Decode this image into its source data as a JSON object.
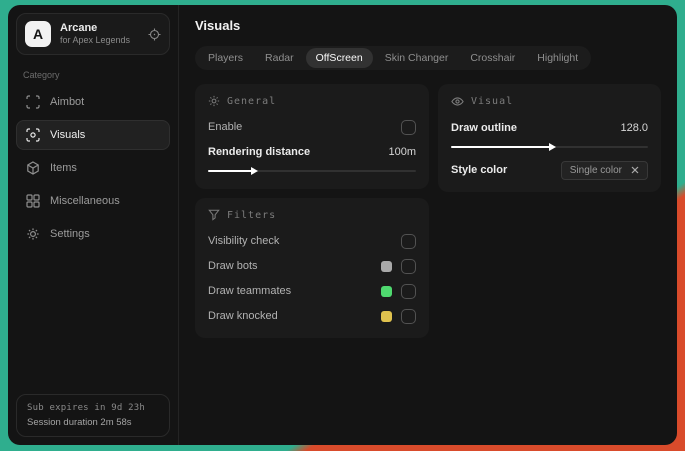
{
  "app": {
    "name": "Arcane",
    "subtitle": "for Apex Legends",
    "logo_letter": "A",
    "header_icon": "target-icon"
  },
  "sidebar": {
    "category_label": "Category",
    "items": [
      {
        "label": "Aimbot",
        "icon": "focus-frame-icon",
        "selected": false
      },
      {
        "label": "Visuals",
        "icon": "eye-scan-icon",
        "selected": true
      },
      {
        "label": "Items",
        "icon": "cube-icon",
        "selected": false
      },
      {
        "label": "Miscellaneous",
        "icon": "grid-icon",
        "selected": false
      },
      {
        "label": "Settings",
        "icon": "gear-icon",
        "selected": false
      }
    ],
    "footer": {
      "sub_expires": "Sub expires in 9d 23h",
      "session_duration": "Session duration 2m 58s"
    }
  },
  "header": {
    "title": "Visuals"
  },
  "tabs": [
    {
      "label": "Players",
      "selected": false
    },
    {
      "label": "Radar",
      "selected": false
    },
    {
      "label": "OffScreen",
      "selected": true
    },
    {
      "label": "Skin Changer",
      "selected": false
    },
    {
      "label": "Crosshair",
      "selected": false
    },
    {
      "label": "Highlight",
      "selected": false
    }
  ],
  "panels": {
    "general": {
      "title": "General",
      "icon": "sun-icon",
      "enable_label": "Enable",
      "rendering_distance_label": "Rendering distance",
      "rendering_distance_value": "100m",
      "rendering_distance_percent": 21
    },
    "filters": {
      "title": "Filters",
      "icon": "funnel-icon",
      "rows": [
        {
          "label": "Visibility check",
          "swatch": null
        },
        {
          "label": "Draw bots",
          "swatch": "#a9a9a9"
        },
        {
          "label": "Draw teammates",
          "swatch": "#4fd96f"
        },
        {
          "label": "Draw knocked",
          "swatch": "#e0c24e"
        }
      ]
    },
    "visual": {
      "title": "Visual",
      "icon": "eye-icon",
      "draw_outline_label": "Draw outline",
      "draw_outline_value": "128.0",
      "draw_outline_percent": 50,
      "style_color_label": "Style color",
      "style_color_value": "Single color",
      "style_color_clear_icon": "close-icon"
    }
  },
  "colors": {
    "background_teal": "#2fae8e",
    "background_red": "#d94b2b",
    "window_bg": "#141414",
    "panel_bg": "#1b1b1b",
    "swatch_gray": "#a9a9a9",
    "swatch_green": "#4fd96f",
    "swatch_yellow": "#e0c24e"
  }
}
